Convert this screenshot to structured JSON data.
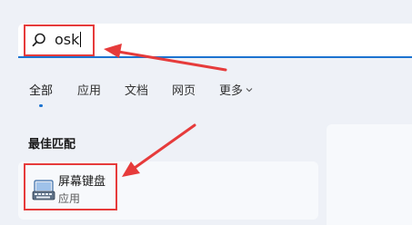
{
  "search": {
    "query": "osk"
  },
  "tabs": [
    {
      "label": "全部",
      "active": true
    },
    {
      "label": "应用",
      "active": false
    },
    {
      "label": "文档",
      "active": false
    },
    {
      "label": "网页",
      "active": false
    },
    {
      "label": "更多",
      "active": false
    }
  ],
  "results": {
    "section_title": "最佳匹配",
    "best_match": {
      "name": "屏幕键盘",
      "type": "应用",
      "icon": "keyboard-icon"
    }
  },
  "colors": {
    "accent": "#1c73d0",
    "annotation": "#e63b3b",
    "background": "#eef1f7",
    "card": "#f7f9fc"
  }
}
